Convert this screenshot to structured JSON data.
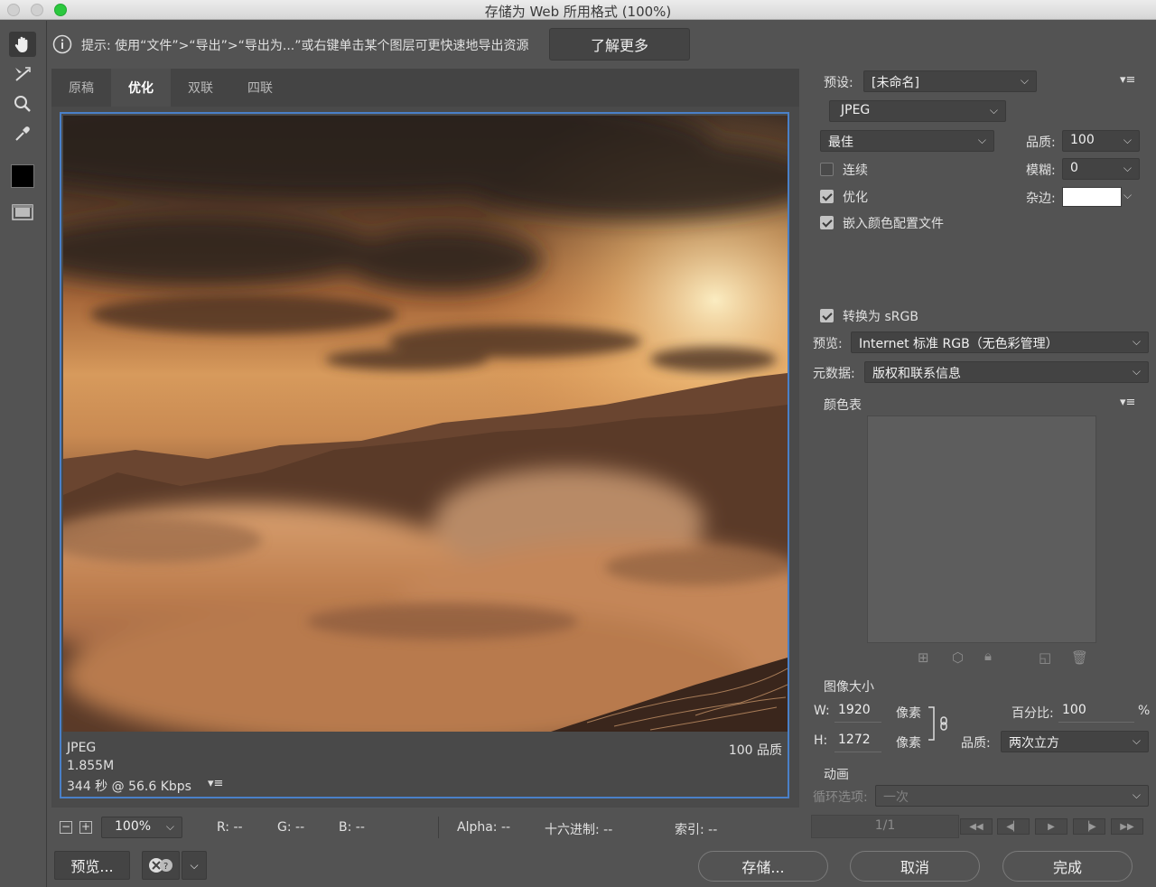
{
  "window": {
    "title": "存储为 Web 所用格式 (100%)"
  },
  "hint": {
    "text": "提示: 使用“文件”>“导出”>“导出为...”或右键单击某个图层可更快速地导出资源",
    "learn_more": "了解更多"
  },
  "tabs": [
    {
      "label": "原稿"
    },
    {
      "label": "优化"
    },
    {
      "label": "双联"
    },
    {
      "label": "四联"
    }
  ],
  "preview_info": {
    "format": "JPEG",
    "size": "1.855M",
    "time": "344 秒 @ 56.6 Kbps",
    "quality": "100 品质"
  },
  "status": {
    "zoom": "100%",
    "r": "R: --",
    "g": "G: --",
    "b": "B: --",
    "alpha": "Alpha: --",
    "hex": "十六进制: --",
    "index": "索引: --"
  },
  "bottom": {
    "preview": "预览...",
    "save": "存储...",
    "cancel": "取消",
    "done": "完成"
  },
  "settings": {
    "preset_label": "预设:",
    "preset_value": "[未命名]",
    "format": "JPEG",
    "compression": "最佳",
    "quality_label": "品质:",
    "quality_value": "100",
    "progressive_label": "连续",
    "blur_label": "模糊:",
    "blur_value": "0",
    "optimized_label": "优化",
    "matte_label": "杂边:",
    "embed_profile_label": "嵌入颜色配置文件",
    "convert_srgb_label": "转换为 sRGB",
    "preview_label": "预览:",
    "preview_value": "Internet 标准 RGB（无色彩管理）",
    "metadata_label": "元数据:",
    "metadata_value": "版权和联系信息",
    "color_table_label": "颜色表",
    "progressive_checked": false,
    "optimized_checked": true,
    "embed_profile_checked": true,
    "convert_srgb_checked": true
  },
  "image_size": {
    "title": "图像大小",
    "w_label": "W:",
    "w_value": "1920",
    "h_label": "H:",
    "h_value": "1272",
    "unit": "像素",
    "percent_label": "百分比:",
    "percent_value": "100",
    "percent_unit": "%",
    "quality_label": "品质:",
    "quality_value": "两次立方"
  },
  "animation": {
    "title": "动画",
    "loop_label": "循环选项:",
    "loop_value": "一次",
    "frame": "1/1"
  },
  "colors": {
    "accent": "#4a80c8",
    "panel": "#535353"
  }
}
